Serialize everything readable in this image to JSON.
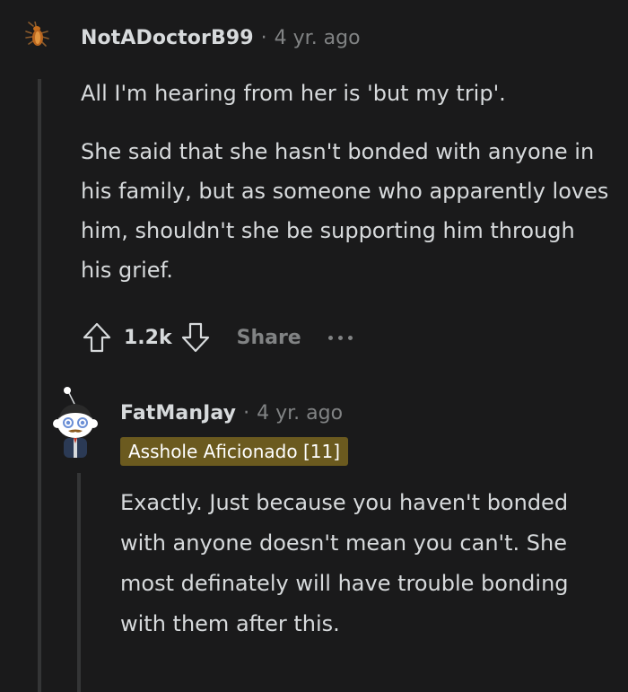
{
  "comment": {
    "author": "NotADoctorB99",
    "separator": "·",
    "time": "4 yr. ago",
    "avatar_icon": "cockroach-icon",
    "paragraphs": [
      "All I'm hearing from her is 'but my trip'.",
      "She said that she hasn't bonded with anyone in his family, but as someone who apparently loves him, shouldn't she be supporting him through his grief."
    ],
    "actions": {
      "upvote_icon": "upvote-arrow-icon",
      "vote_count": "1.2k",
      "downvote_icon": "downvote-arrow-icon",
      "share_label": "Share",
      "more_icon": "more-options-icon"
    }
  },
  "reply": {
    "author": "FatManJay",
    "separator": "·",
    "time": "4 yr. ago",
    "avatar_icon": "snoo-avatar-icon",
    "flair": "Asshole Aficionado [11]",
    "paragraphs": [
      "Exactly. Just because you haven't bonded with anyone doesn't mean you can't. She most definately will have trouble bonding with them after this."
    ]
  },
  "colors": {
    "background": "#1a1a1b",
    "text": "#d7dadc",
    "muted": "#818384",
    "thread_line": "#343536",
    "flair_bg": "#6b5a1f"
  }
}
